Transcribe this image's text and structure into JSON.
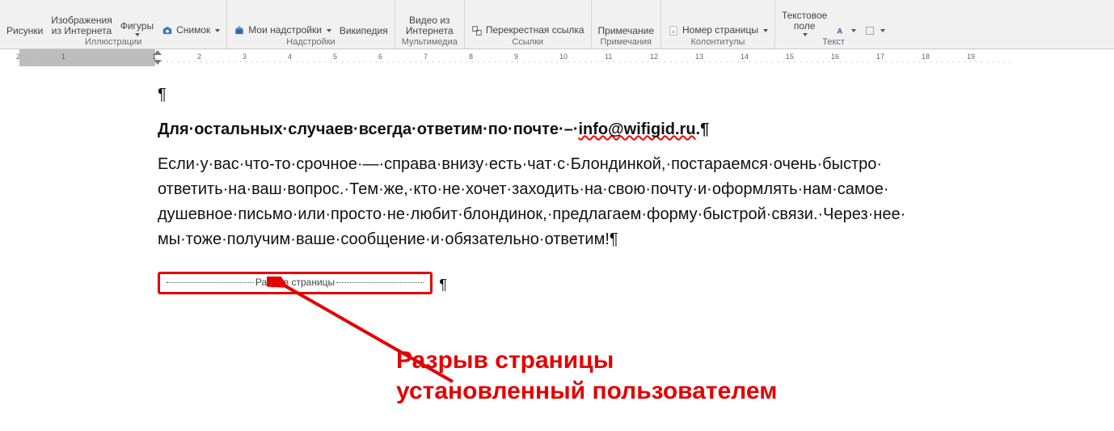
{
  "ribbon": {
    "groups": {
      "illustrations": {
        "title": "Иллюстрации",
        "b1": "Рисунки",
        "b2": "Изображения\nиз Интернета",
        "b3": "Фигуры",
        "b4": "Снимок"
      },
      "addins": {
        "title": "Надстройки",
        "b1": "Мои надстройки",
        "b2": "Википедия"
      },
      "media": {
        "title": "Мультимедиа",
        "b1": "Видео из\nИнтернета"
      },
      "links": {
        "title": "Ссылки",
        "b1": "Перекрестная ссылка"
      },
      "comments": {
        "title": "Примечания",
        "b1": "Примечание"
      },
      "headerfooter": {
        "title": "Колонтитулы",
        "b1": "Номер страницы"
      },
      "text": {
        "title": "Текст",
        "b1": "Текстовое\nполе"
      }
    }
  },
  "ruler": {
    "marks": [
      2,
      1,
      "",
      1,
      2,
      3,
      4,
      5,
      6,
      7,
      8,
      9,
      10,
      11,
      12,
      13,
      14,
      15,
      16,
      17,
      18,
      19
    ]
  },
  "doc": {
    "pilcrow": "¶",
    "bold_line_pre": "Для·остальных·случаев·всегда·ответим·по·почте·–·",
    "bold_line_err": "info@wifigid.ru",
    "bold_line_post": ".¶",
    "body1": "Если·у·вас·что-то·срочное·—·справа·внизу·есть·чат·с·Блондинкой,·постараемся·очень·быстро·",
    "body2": "ответить·на·ваш·вопрос.·Тем·же,·кто·не·хочет·заходить·на·свою·почту·и·оформлять·нам·самое·",
    "body3": "душевное·письмо·или·просто·не·любит·блондинок,·предлагаем·форму·быстрой·связи.·Через·нее·",
    "body4": "мы·тоже·получим·ваше·сообщение·и·обязательно·ответим!¶",
    "page_break_label": "Разрыв страницы"
  },
  "annotation": {
    "line1": "Разрыв страницы",
    "line2": "установленный пользователем"
  }
}
